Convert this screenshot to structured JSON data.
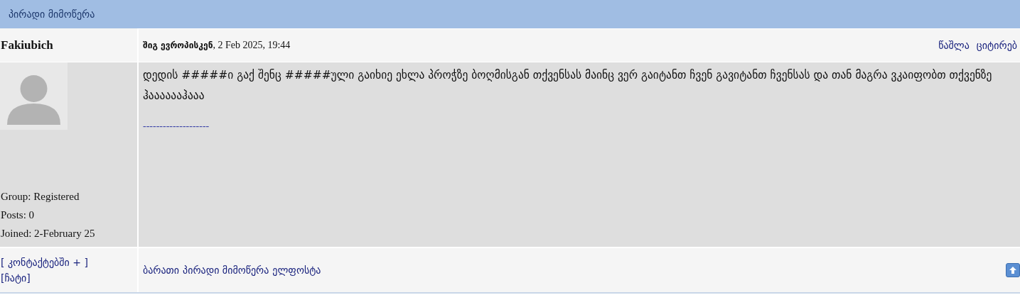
{
  "header": {
    "title": "პირადი მიმოწერა"
  },
  "post": {
    "author": "Fakiubich",
    "title": "შიგ ევროპისკენ",
    "date": ", 2 Feb 2025, 19:44",
    "actions": [
      "წაშლა",
      "ციტირებ"
    ],
    "body": "დედის #####ი გაქ შენც #####ული გაიხიე ეხლა პროჭზე ბოღმისგან თქვენსას მაინც ვერ გაიტანთ ჩვენ გავიტანთ ჩვენსას და თან მაგრა ვკაიფობთ თქვენზე ჰააააააჰააა",
    "signature": "--------------------",
    "info": [
      "Group: Registered",
      "Posts: 0",
      "Joined: 2-February 25"
    ],
    "user_links": [
      "[ კონტაქტებში + ]",
      "[ჩატი]"
    ],
    "footer_links": [
      "ბარათი",
      "პირადი მიმოწერა",
      "ელფოსტა"
    ]
  }
}
